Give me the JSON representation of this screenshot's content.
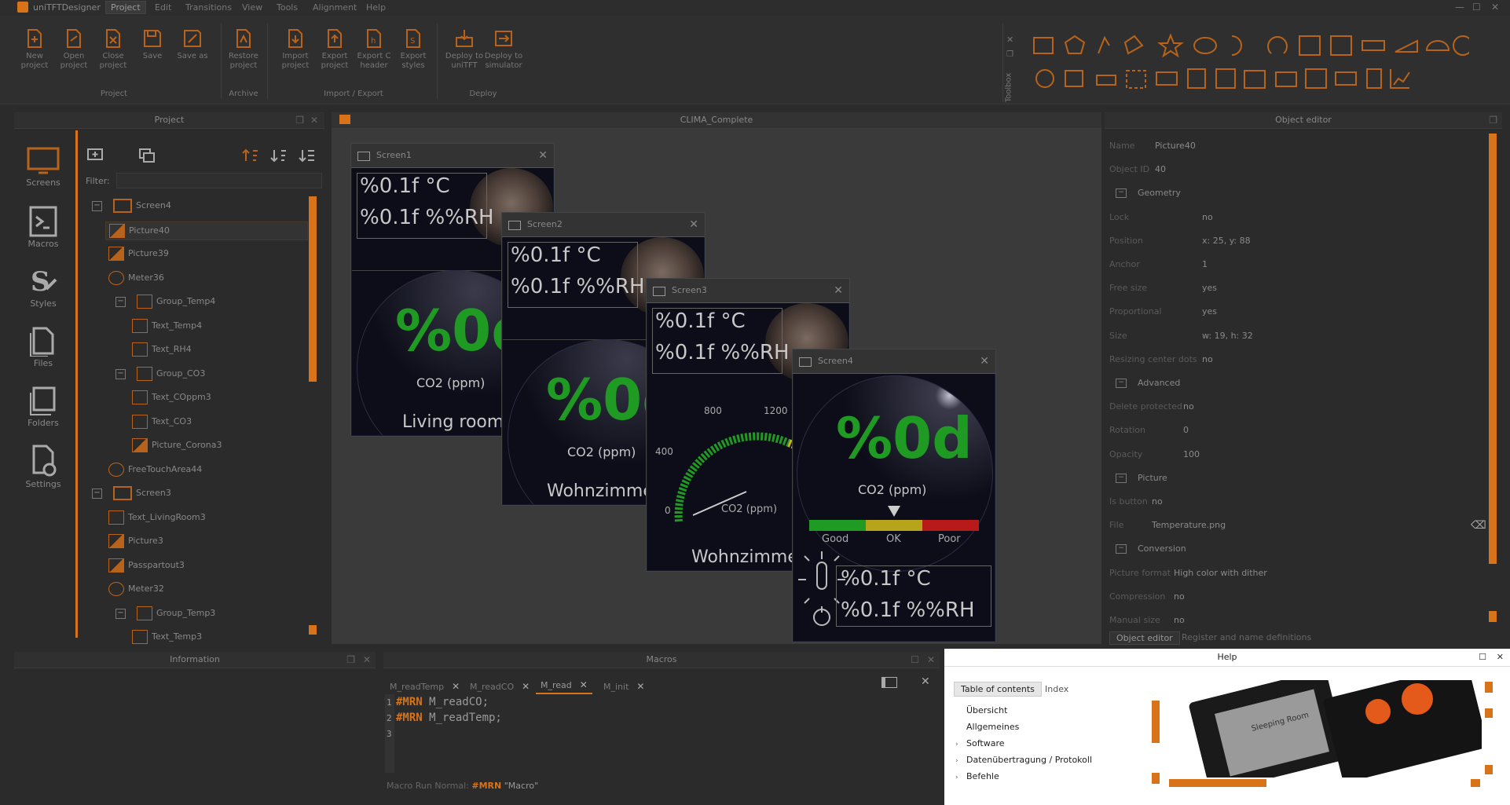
{
  "app": {
    "title": "uniTFTDesigner",
    "menu": [
      "Project",
      "Edit",
      "Transitions",
      "View",
      "Tools",
      "Alignment",
      "Help"
    ]
  },
  "ribbon": {
    "project_buttons": [
      {
        "line1": "New",
        "line2": "project",
        "icon": "new-project-icon"
      },
      {
        "line1": "Open",
        "line2": "project",
        "icon": "open-project-icon"
      },
      {
        "line1": "Close",
        "line2": "project",
        "icon": "close-project-icon"
      },
      {
        "line1": "Save",
        "line2": "",
        "icon": "save-icon"
      },
      {
        "line1": "Save as",
        "line2": "",
        "icon": "save-as-icon"
      }
    ],
    "archive_buttons": [
      {
        "line1": "Restore",
        "line2": "project",
        "icon": "restore-project-icon"
      }
    ],
    "import_export_buttons": [
      {
        "line1": "Import",
        "line2": "project",
        "icon": "import-project-icon"
      },
      {
        "line1": "Export",
        "line2": "project",
        "icon": "export-project-icon"
      },
      {
        "line1": "Export C",
        "line2": "header",
        "icon": "export-c-header-icon"
      },
      {
        "line1": "Export",
        "line2": "styles",
        "icon": "export-styles-icon"
      }
    ],
    "deploy_buttons": [
      {
        "line1": "Deploy to",
        "line2": "uniTFT",
        "icon": "deploy-unitft-icon"
      },
      {
        "line1": "Deploy to",
        "line2": "simulator",
        "icon": "deploy-simulator-icon"
      }
    ],
    "groups": {
      "project": "Project",
      "archive": "Archive",
      "import_export": "Import / Export",
      "deploy": "Deploy"
    },
    "toolbox_label": "Toolbox"
  },
  "project_panel": {
    "title": "Project",
    "filter_label": "Filter:",
    "filter_value": "",
    "side_nav": [
      "Screens",
      "Macros",
      "Styles",
      "Files",
      "Folders",
      "Settings"
    ],
    "tree": [
      {
        "label": "Screen4",
        "indent": 0,
        "type": "screen",
        "expander": "−"
      },
      {
        "label": "Picture40",
        "indent": 1,
        "type": "picture",
        "selected": true
      },
      {
        "label": "Picture39",
        "indent": 1,
        "type": "picture"
      },
      {
        "label": "Meter36",
        "indent": 1,
        "type": "meter"
      },
      {
        "label": "Group_Temp4",
        "indent": 1,
        "type": "group",
        "expander": "−"
      },
      {
        "label": "Text_Temp4",
        "indent": 2,
        "type": "text"
      },
      {
        "label": "Text_RH4",
        "indent": 2,
        "type": "text"
      },
      {
        "label": "Group_CO3",
        "indent": 1,
        "type": "group",
        "expander": "−"
      },
      {
        "label": "Text_COppm3",
        "indent": 2,
        "type": "text"
      },
      {
        "label": "Text_CO3",
        "indent": 2,
        "type": "text"
      },
      {
        "label": "Picture_Corona3",
        "indent": 2,
        "type": "picture"
      },
      {
        "label": "FreeTouchArea44",
        "indent": 1,
        "type": "touch"
      },
      {
        "label": "Screen3",
        "indent": 0,
        "type": "screen",
        "expander": "−"
      },
      {
        "label": "Text_LivingRoom3",
        "indent": 1,
        "type": "text"
      },
      {
        "label": "Picture3",
        "indent": 1,
        "type": "picture"
      },
      {
        "label": "Passpartout3",
        "indent": 1,
        "type": "picture"
      },
      {
        "label": "Meter32",
        "indent": 1,
        "type": "meter"
      },
      {
        "label": "Group_Temp3",
        "indent": 1,
        "type": "group",
        "expander": "−"
      },
      {
        "label": "Text_Temp3",
        "indent": 2,
        "type": "text"
      }
    ]
  },
  "canvas": {
    "title": "CLIMA_Complete",
    "screens": [
      {
        "name": "Screen1",
        "temp": "%0.1f °C",
        "rh": "%0.1f %%RH",
        "co2": "%0d",
        "co2_label": "CO2 (ppm)",
        "room": "Living room"
      },
      {
        "name": "Screen2",
        "temp": "%0.1f °C",
        "rh": "%0.1f %%RH",
        "co2": "%0d",
        "co2_label": "CO2 (ppm)",
        "room": "Wohnzimme"
      },
      {
        "name": "Screen3",
        "temp": "%0.1f °C",
        "rh": "%0.1f %%RH",
        "room": "Wohnzimme",
        "gauge_label": "CO2 (ppm)",
        "ticks": [
          "0",
          "400",
          "800",
          "1200"
        ]
      },
      {
        "name": "Screen4",
        "co2": "%0d",
        "co2_label": "CO2 (ppm)",
        "scale": [
          "Good",
          "OK",
          "Poor"
        ],
        "temp": "%0.1f °C",
        "rh": "%0.1f %%RH"
      }
    ]
  },
  "object_editor": {
    "title": "Object editor",
    "rows": [
      {
        "label": "Name",
        "value": "Picture40"
      },
      {
        "label": "Object ID",
        "value": "40"
      }
    ],
    "sections": [
      {
        "title": "Geometry",
        "rows": [
          {
            "label": "Lock",
            "value": "no"
          },
          {
            "label": "Position",
            "value": "x: 25,  y: 88"
          },
          {
            "label": "Anchor",
            "value": "1"
          },
          {
            "label": "Free size",
            "value": "yes"
          },
          {
            "label": "Proportional",
            "value": "yes"
          },
          {
            "label": "Size",
            "value": "w: 19,  h: 32"
          },
          {
            "label": "Resizing center dots",
            "value": "no"
          }
        ]
      },
      {
        "title": "Advanced",
        "rows": [
          {
            "label": "Delete protected",
            "value": "no"
          },
          {
            "label": "Rotation",
            "value": "0"
          },
          {
            "label": "Opacity",
            "value": "100"
          }
        ]
      },
      {
        "title": "Picture",
        "rows": [
          {
            "label": "Is button",
            "value": "no"
          },
          {
            "label": "File",
            "value": "Temperature.png"
          }
        ]
      },
      {
        "title": "Conversion",
        "rows": [
          {
            "label": "Picture format",
            "value": "High color with dither"
          },
          {
            "label": "Compression",
            "value": "no"
          },
          {
            "label": "Manual size",
            "value": "no"
          }
        ]
      }
    ],
    "bottom_tabs": [
      "Object editor",
      "Register and name definitions"
    ]
  },
  "information": {
    "title": "Information"
  },
  "macros": {
    "title": "Macros",
    "tabs": [
      "M_readTemp",
      "M_readCO",
      "M_read",
      "M_init"
    ],
    "active_tab": "M_read",
    "lines": [
      {
        "num": "1",
        "kw": "#MRN",
        "text": " M_readCO;"
      },
      {
        "num": "2",
        "kw": "#MRN",
        "text": " M_readTemp;"
      },
      {
        "num": "3",
        "kw": "",
        "text": ""
      }
    ],
    "status": {
      "prefix": "Macro Run Normal: ",
      "kw": "#MRN",
      "suffix": " \"Macro\""
    }
  },
  "help": {
    "title": "Help",
    "tabs": [
      "Table of contents",
      "Index"
    ],
    "items": [
      "Übersicht",
      "Allgemeines",
      "Software",
      "Datenübertragung / Protokoll",
      "Befehle"
    ],
    "expandable": [
      false,
      false,
      true,
      true,
      true
    ],
    "image_caption": "Sleeping Room"
  },
  "colors": {
    "accent": "#d9731a",
    "lcd_green": "#1f9a22",
    "bg": "#2b2b2b"
  }
}
